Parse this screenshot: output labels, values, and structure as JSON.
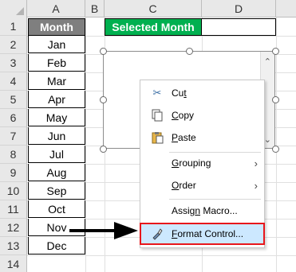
{
  "columns": [
    "A",
    "B",
    "C",
    "D"
  ],
  "rows": [
    "1",
    "2",
    "3",
    "4",
    "5",
    "6",
    "7",
    "8",
    "9",
    "10",
    "11",
    "12",
    "13",
    "14"
  ],
  "month_header": "Month",
  "months": [
    "Jan",
    "Feb",
    "Mar",
    "Apr",
    "May",
    "Jun",
    "Jul",
    "Aug",
    "Sep",
    "Oct",
    "Nov",
    "Dec"
  ],
  "selected_month_label": "Selected Month",
  "context_menu": {
    "cut": {
      "pre": "Cu",
      "ul": "t",
      "post": ""
    },
    "copy": {
      "pre": "",
      "ul": "C",
      "post": "opy"
    },
    "paste": {
      "pre": "",
      "ul": "P",
      "post": "aste"
    },
    "grouping": {
      "pre": "",
      "ul": "G",
      "post": "rouping"
    },
    "order": {
      "pre": "",
      "ul": "O",
      "post": "rder"
    },
    "assign_macro": {
      "pre": "Assig",
      "ul": "n",
      "post": " Macro..."
    },
    "format_control": {
      "pre": "",
      "ul": "F",
      "post": "ormat Control..."
    }
  },
  "icons": {
    "cut": "scissors-icon",
    "copy": "copy-icon",
    "paste": "paste-icon",
    "format_control": "format-control-icon",
    "submenu": "chevron-right-icon"
  },
  "colors": {
    "month_header_bg": "#7f7f7f",
    "selected_month_bg": "#00b050",
    "highlight_border": "#e8161b",
    "menu_highlight_bg": "#cce8ff"
  }
}
